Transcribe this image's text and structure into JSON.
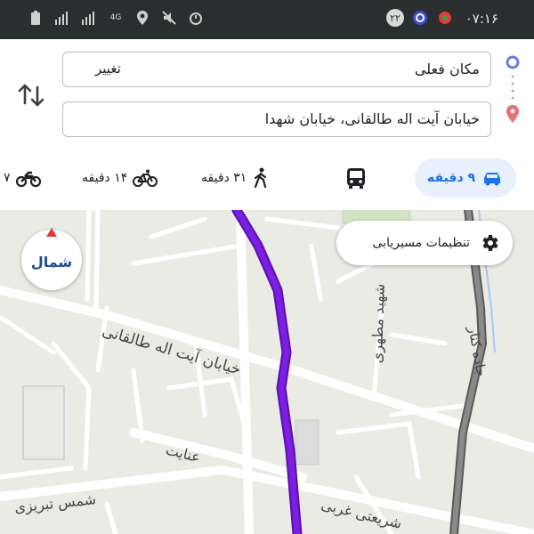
{
  "status_bar": {
    "time": "۰۷:۱۶",
    "badge_number": "۲۲",
    "network": "4G"
  },
  "directions": {
    "origin": "مکان فعلی",
    "origin_action": "تغییر",
    "destination": "خیابان آیت اله طالقانی، خیابان شهدا"
  },
  "modes": {
    "car": {
      "time": "۹ دقیقه",
      "icon": "car-icon"
    },
    "transit": {
      "icon": "bus-icon"
    },
    "walk": {
      "time": "۳۱ دقیقه",
      "icon": "walk-icon"
    },
    "bike": {
      "time": "۱۴ دقیقه",
      "icon": "bike-icon"
    },
    "motorcycle": {
      "time": "۷",
      "icon": "motorcycle-icon"
    }
  },
  "map": {
    "compass_label": "شمال",
    "route_settings_label": "تنظیمات مسیریابی",
    "streets": {
      "taleghani": "خیابان آیت اله طالقانی",
      "motahari": "شهید مطهری",
      "enayat": "عنایت",
      "shams": "شمس تبریزی",
      "shariati": "شریعتی غربی",
      "highway": "جاده کنار"
    }
  },
  "colors": {
    "route": "#7b1fe0",
    "accent": "#1a73e8",
    "highway": "#6e6e6e"
  }
}
